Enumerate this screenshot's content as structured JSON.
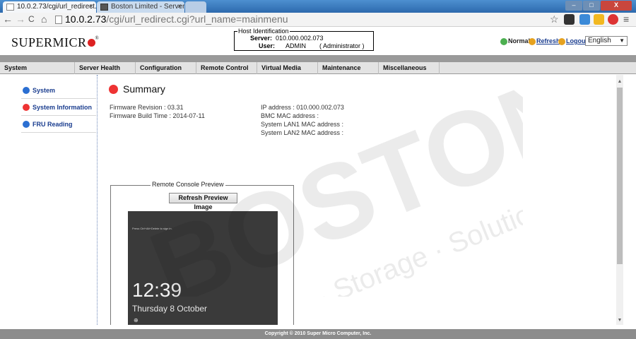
{
  "browser": {
    "tabs": [
      {
        "title": "10.0.2.73/cgi/url_redirect.c"
      },
      {
        "title": "Boston Limited - Server, S"
      }
    ],
    "tab_close": "×",
    "address_host": "10.0.2.73",
    "address_path": "/cgi/url_redirect.cgi?url_name=mainmenu",
    "nav_back": "←",
    "nav_forward": "→",
    "nav_reload": "C",
    "nav_home": "⌂",
    "star": "☆",
    "menu": "≡",
    "window_min": "–",
    "window_max": "□",
    "window_close": "X"
  },
  "header": {
    "logo_text": "SUPERMICR",
    "logo_tm": "®",
    "host_legend": "Host Identification",
    "server_label": "Server:",
    "server_value": "010.000.002.073",
    "user_label": "User:",
    "user_value": "ADMIN",
    "user_role": "( Administrator )",
    "status_normal": "Normal",
    "refresh_link": "Refresh",
    "logout_link": "Logout",
    "language": "English"
  },
  "nav": {
    "items": [
      "System",
      "Server Health",
      "Configuration",
      "Remote Control",
      "Virtual Media",
      "Maintenance",
      "Miscellaneous"
    ]
  },
  "sidebar": {
    "items": [
      {
        "label": "System"
      },
      {
        "label": "System Information"
      },
      {
        "label": "FRU Reading"
      }
    ]
  },
  "summary": {
    "title": "Summary",
    "firmware_revision": "Firmware Revision : 03.31",
    "firmware_build": "Firmware Build Time : 2014-07-11",
    "ip_address": "IP address : 010.000.002.073",
    "bmc_mac": "BMC MAC address :",
    "lan1_mac": "System LAN1 MAC address :",
    "lan2_mac": "System LAN2 MAC address :"
  },
  "preview": {
    "legend": "Remote Console Preview",
    "refresh_button": "Refresh Preview Image",
    "hint": "Press Ctrl+Alt+Delete to sign in.",
    "time": "12:39",
    "date": "Thursday 8 October"
  },
  "footer": {
    "copyright": "Copyright © 2010 Super Micro Computer, Inc."
  },
  "watermark": {
    "brand": "BOSTON",
    "tagline": "Servers · Storage · Solutions"
  },
  "colors": {
    "link": "#1a3d8f",
    "accent_red": "#ee3333",
    "nav_bg": "#e3e3e3",
    "footer_bg": "#8c8c8c"
  }
}
